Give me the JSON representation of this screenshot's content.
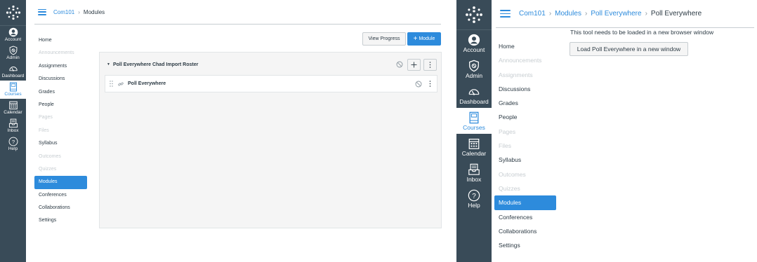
{
  "global_nav": {
    "items": [
      {
        "label": "Account",
        "icon": "account-icon",
        "active": false
      },
      {
        "label": "Admin",
        "icon": "shield-icon",
        "active": false
      },
      {
        "label": "Dashboard",
        "icon": "dashboard-icon",
        "active": false
      },
      {
        "label": "Courses",
        "icon": "courses-icon",
        "active": true
      },
      {
        "label": "Calendar",
        "icon": "calendar-icon",
        "active": false
      },
      {
        "label": "Inbox",
        "icon": "inbox-icon",
        "active": false
      },
      {
        "label": "Help",
        "icon": "help-icon",
        "active": false
      }
    ]
  },
  "course_nav": {
    "items": [
      {
        "label": "Home",
        "state": "normal"
      },
      {
        "label": "Announcements",
        "state": "disabled"
      },
      {
        "label": "Assignments",
        "state": "normal"
      },
      {
        "label": "Discussions",
        "state": "normal"
      },
      {
        "label": "Grades",
        "state": "normal"
      },
      {
        "label": "People",
        "state": "normal"
      },
      {
        "label": "Pages",
        "state": "disabled"
      },
      {
        "label": "Files",
        "state": "disabled"
      },
      {
        "label": "Syllabus",
        "state": "normal"
      },
      {
        "label": "Outcomes",
        "state": "disabled"
      },
      {
        "label": "Quizzes",
        "state": "disabled"
      },
      {
        "label": "Modules",
        "state": "active"
      },
      {
        "label": "Conferences",
        "state": "normal"
      },
      {
        "label": "Collaborations",
        "state": "normal"
      },
      {
        "label": "Settings",
        "state": "normal"
      }
    ],
    "right_items": [
      {
        "label": "Home",
        "state": "normal"
      },
      {
        "label": "Announcements",
        "state": "disabled"
      },
      {
        "label": "Assignments",
        "state": "disabled"
      },
      {
        "label": "Discussions",
        "state": "normal"
      },
      {
        "label": "Grades",
        "state": "normal"
      },
      {
        "label": "People",
        "state": "normal"
      },
      {
        "label": "Pages",
        "state": "disabled"
      },
      {
        "label": "Files",
        "state": "disabled"
      },
      {
        "label": "Syllabus",
        "state": "normal"
      },
      {
        "label": "Outcomes",
        "state": "disabled"
      },
      {
        "label": "Quizzes",
        "state": "disabled"
      },
      {
        "label": "Modules",
        "state": "active"
      },
      {
        "label": "Conferences",
        "state": "normal"
      },
      {
        "label": "Collaborations",
        "state": "normal"
      },
      {
        "label": "Settings",
        "state": "normal"
      }
    ]
  },
  "left": {
    "breadcrumb": {
      "course": "Com101",
      "current": "Modules"
    },
    "view_progress_label": "View Progress",
    "add_module_label": "Module",
    "module": {
      "title": "Poll Everywhere Chad Import Roster",
      "item_title": "Poll Everywhere"
    }
  },
  "right": {
    "breadcrumb": {
      "course": "Com101",
      "modules": "Modules",
      "tool": "Poll Everywhere",
      "current": "Poll Everywhere"
    },
    "message": "This tool needs to be loaded in a new browser window",
    "load_button_label": "Load Poll Everywhere in a new window"
  },
  "colors": {
    "accent": "#2d8bdc",
    "nav_bg": "#394b58",
    "disabled_text": "#c7cdd1"
  }
}
